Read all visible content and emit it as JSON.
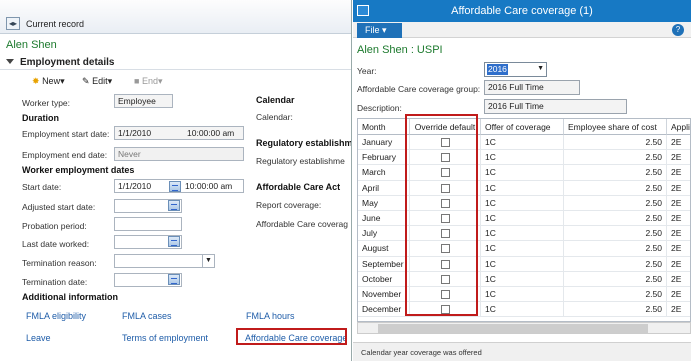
{
  "left": {
    "current_record": "Current record",
    "worker_name": "Alen Shen",
    "section_title": "Employment details",
    "toolbar": {
      "new": "New",
      "edit": "Edit",
      "end": "End"
    },
    "worker_type": {
      "label": "Worker type:",
      "value": "Employee"
    },
    "duration": {
      "heading": "Duration",
      "start_label": "Employment start date:",
      "start_date": "1/1/2010",
      "start_time": "10:00:00 am",
      "end_label": "Employment end date:",
      "end_value": "Never"
    },
    "worker_employment": {
      "heading": "Worker employment dates",
      "start_label": "Start date:",
      "start_date": "1/1/2010",
      "start_time": "10:00:00 am",
      "adjusted_label": "Adjusted start date:",
      "probation_label": "Probation period:",
      "last_worked_label": "Last date worked:",
      "termination_reason_label": "Termination reason:",
      "termination_date_label": "Termination date:"
    },
    "calendar": {
      "heading": "Calendar",
      "label": "Calendar:"
    },
    "regulatory": {
      "heading": "Regulatory establishme",
      "label": "Regulatory establishme"
    },
    "aca": {
      "heading": "Affordable Care Act",
      "report_label": "Report coverage:",
      "coverage_label": "Affordable Care coverag"
    },
    "additional": {
      "heading": "Additional information",
      "links": [
        "FMLA eligibility",
        "FMLA cases",
        "FMLA hours",
        "Leave",
        "Terms of employment",
        "Affordable Care coverage"
      ]
    }
  },
  "right": {
    "title": "Affordable Care coverage (1)",
    "menu_file": "File",
    "worker": "Alen Shen : USPI",
    "year": {
      "label": "Year:",
      "value": "2016"
    },
    "group": {
      "label": "Affordable Care coverage group:",
      "value": "2016 Full Time"
    },
    "description": {
      "label": "Description:",
      "value": "2016 Full Time"
    },
    "columns": [
      "Month",
      "Override default",
      "Offer of coverage",
      "Employee share of cost",
      "Applic"
    ],
    "rows": [
      {
        "month": "January",
        "offer": "1C",
        "share": "2.50",
        "applic": "2E"
      },
      {
        "month": "February",
        "offer": "1C",
        "share": "2.50",
        "applic": "2E"
      },
      {
        "month": "March",
        "offer": "1C",
        "share": "2.50",
        "applic": "2E"
      },
      {
        "month": "April",
        "offer": "1C",
        "share": "2.50",
        "applic": "2E"
      },
      {
        "month": "May",
        "offer": "1C",
        "share": "2.50",
        "applic": "2E"
      },
      {
        "month": "June",
        "offer": "1C",
        "share": "2.50",
        "applic": "2E"
      },
      {
        "month": "July",
        "offer": "1C",
        "share": "2.50",
        "applic": "2E"
      },
      {
        "month": "August",
        "offer": "1C",
        "share": "2.50",
        "applic": "2E"
      },
      {
        "month": "September",
        "offer": "1C",
        "share": "2.50",
        "applic": "2E"
      },
      {
        "month": "October",
        "offer": "1C",
        "share": "2.50",
        "applic": "2E"
      },
      {
        "month": "November",
        "offer": "1C",
        "share": "2.50",
        "applic": "2E"
      },
      {
        "month": "December",
        "offer": "1C",
        "share": "2.50",
        "applic": "2E"
      }
    ],
    "status": "Calendar year coverage was offered"
  },
  "colors": {
    "accent": "#1779c4",
    "highlight": "#c01b1b",
    "worker_green": "#1d7a2e",
    "link": "#1e5ca8"
  }
}
